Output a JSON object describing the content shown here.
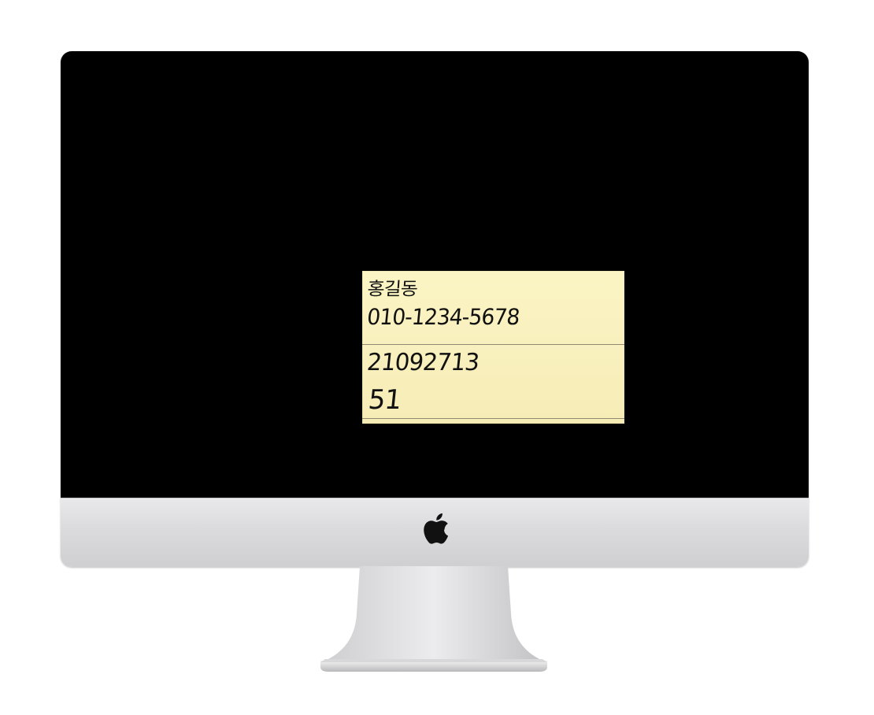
{
  "sticky_note": {
    "line1": "홍길동",
    "line2": "010-1234-5678",
    "line3": "21092713",
    "line4": "51"
  },
  "colors": {
    "screen": "#000000",
    "note": "#f8f0bd",
    "chin": "#dcdcde",
    "ink": "#111111"
  },
  "icons": {
    "brand": "apple-logo-icon"
  }
}
